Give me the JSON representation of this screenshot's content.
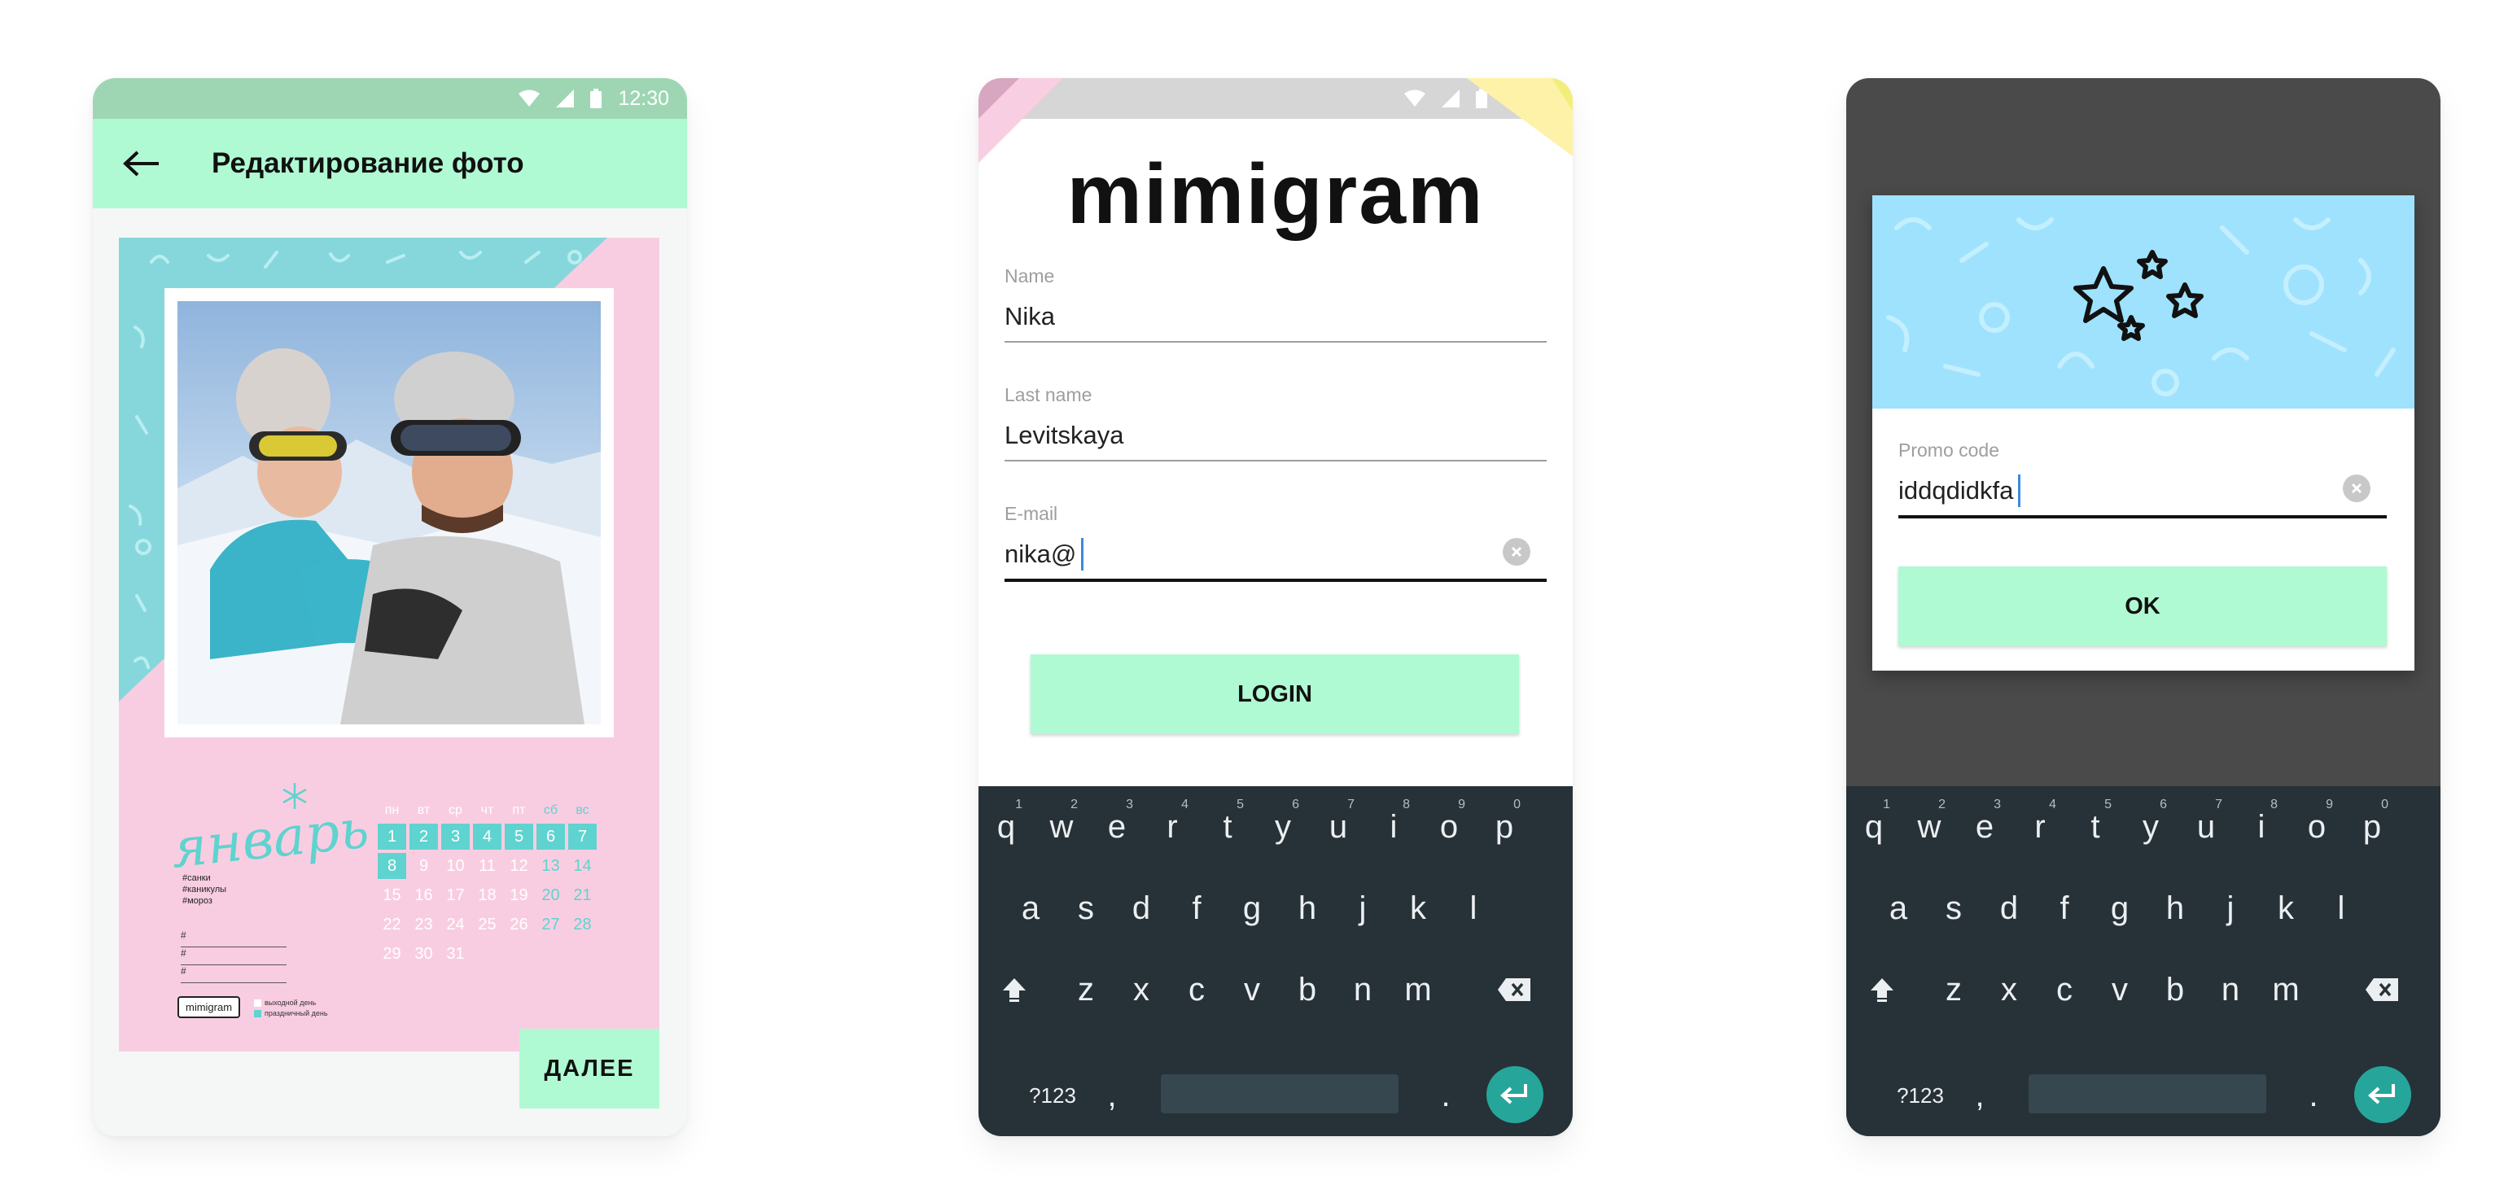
{
  "status": {
    "time": "12:30"
  },
  "screen1": {
    "title": "Редактирование фото",
    "calendar": {
      "month": "январь",
      "tags": [
        "#санки",
        "#каникулы",
        "#мороз"
      ],
      "note_lines": [
        "#",
        "#",
        "#"
      ],
      "weekdays": [
        "пн",
        "вт",
        "ср",
        "чт",
        "пт",
        "сб",
        "вс"
      ],
      "rows": [
        [
          "1",
          "2",
          "3",
          "4",
          "5",
          "6",
          "7"
        ],
        [
          "8",
          "9",
          "10",
          "11",
          "12",
          "13",
          "14"
        ],
        [
          "15",
          "16",
          "17",
          "18",
          "19",
          "20",
          "21"
        ],
        [
          "22",
          "23",
          "24",
          "25",
          "26",
          "27",
          "28"
        ],
        [
          "29",
          "30",
          "31",
          "",
          "",
          "",
          ""
        ]
      ],
      "legend": [
        "выходной день",
        "праздничный день"
      ],
      "brand": "mimigram"
    },
    "next_label": "ДАЛЕЕ"
  },
  "screen2": {
    "logo": "mimigram",
    "fields": [
      {
        "label": "Name",
        "value": "Nika"
      },
      {
        "label": "Last name",
        "value": "Levitskaya"
      },
      {
        "label": "E-mail",
        "value": "nika@"
      }
    ],
    "login_label": "LOGIN"
  },
  "screen3": {
    "promo_label": "Promo code",
    "promo_value": "iddqdidkfa",
    "ok_label": "OK"
  },
  "keyboard": {
    "row1": [
      {
        "key": "q",
        "hint": "1"
      },
      {
        "key": "w",
        "hint": "2"
      },
      {
        "key": "e",
        "hint": "3"
      },
      {
        "key": "r",
        "hint": "4"
      },
      {
        "key": "t",
        "hint": "5"
      },
      {
        "key": "y",
        "hint": "6"
      },
      {
        "key": "u",
        "hint": "7"
      },
      {
        "key": "i",
        "hint": "8"
      },
      {
        "key": "o",
        "hint": "9"
      },
      {
        "key": "p",
        "hint": "0"
      }
    ],
    "row2": [
      "a",
      "s",
      "d",
      "f",
      "g",
      "h",
      "j",
      "k",
      "l"
    ],
    "row3": [
      "z",
      "x",
      "c",
      "v",
      "b",
      "n",
      "m"
    ],
    "symbols_label": "?123",
    "comma": ",",
    "period": "."
  },
  "colors": {
    "mint": "#b0fad3",
    "teal": "#5fd3cf",
    "pink": "#f9cde1",
    "keyboard_bg": "#263238",
    "enter_bg": "#26a69a"
  }
}
